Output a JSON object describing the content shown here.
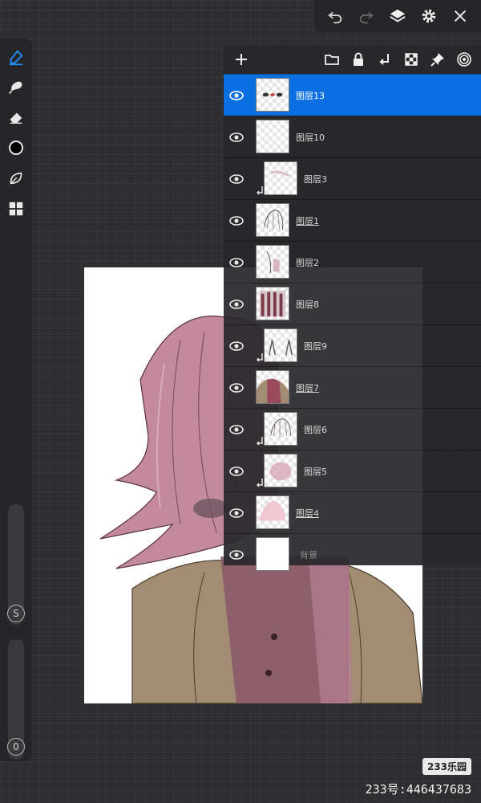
{
  "colors": {
    "panel": "#28282b",
    "selected_row": "#0a6fe0",
    "hair": "#c28a9c",
    "jacket": "#a28d72",
    "scarf": "#8a5a6a"
  },
  "top_toolbar": {
    "icons": [
      "undo-icon",
      "redo-icon",
      "layers-icon",
      "gear-icon",
      "close-icon"
    ]
  },
  "left_toolbar": {
    "tools": [
      "brush-icon",
      "smudge-icon",
      "eraser-icon",
      "color-swatch",
      "leaf-icon",
      "grid-icon"
    ],
    "size_slider_label": "S",
    "opacity_slider_label": "0"
  },
  "layers_toolbar": {
    "icons": [
      "add-icon",
      "folder-icon",
      "lock-icon",
      "clip-arrow-icon",
      "checker-icon",
      "pin-icon",
      "spiral-icon"
    ]
  },
  "layers": [
    {
      "name": "图层13",
      "selected": true,
      "clipped": false,
      "underline": false
    },
    {
      "name": "图层10",
      "selected": false,
      "clipped": false,
      "underline": false
    },
    {
      "name": "图层3",
      "selected": false,
      "clipped": true,
      "underline": false
    },
    {
      "name": "图层1",
      "selected": false,
      "clipped": false,
      "underline": true
    },
    {
      "name": "图层2",
      "selected": false,
      "clipped": false,
      "underline": false
    },
    {
      "name": "图层8",
      "selected": false,
      "clipped": false,
      "underline": false
    },
    {
      "name": "图层9",
      "selected": false,
      "clipped": true,
      "underline": false
    },
    {
      "name": "图层7",
      "selected": false,
      "clipped": false,
      "underline": true
    },
    {
      "name": "图层6",
      "selected": false,
      "clipped": true,
      "underline": false
    },
    {
      "name": "图层5",
      "selected": false,
      "clipped": true,
      "underline": false
    },
    {
      "name": "图层4",
      "selected": false,
      "clipped": false,
      "underline": true
    },
    {
      "name": "背景",
      "selected": false,
      "clipped": false,
      "underline": false
    }
  ],
  "watermark": {
    "badge": "233乐园",
    "text": "233号:446437683"
  }
}
